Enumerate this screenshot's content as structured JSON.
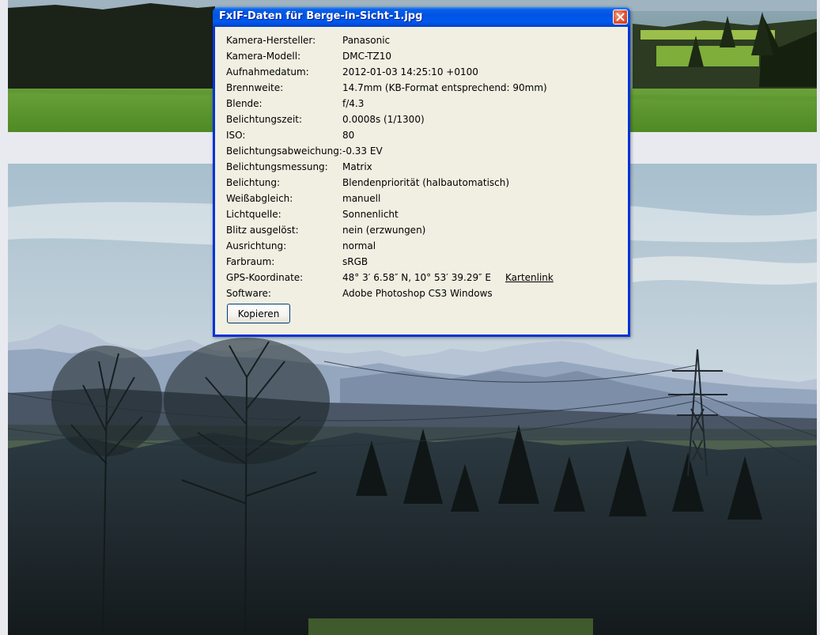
{
  "dialog": {
    "title": "FxIF-Daten für Berge-in-Sicht-1.jpg",
    "close_icon": "close-icon",
    "rows": [
      {
        "label": "Kamera-Hersteller:",
        "value": "Panasonic"
      },
      {
        "label": "Kamera-Modell:",
        "value": "DMC-TZ10"
      },
      {
        "label": "Aufnahmedatum:",
        "value": "2012-01-03 14:25:10 +0100"
      },
      {
        "label": "Brennweite:",
        "value": "14.7mm (KB-Format entsprechend: 90mm)"
      },
      {
        "label": "Blende:",
        "value": "f/4.3"
      },
      {
        "label": "Belichtungszeit:",
        "value": "0.0008s (1/1300)"
      },
      {
        "label": "ISO:",
        "value": "80"
      },
      {
        "label": "Belichtungsabweichung:",
        "value": "-0.33 EV"
      },
      {
        "label": "Belichtungsmessung:",
        "value": "Matrix"
      },
      {
        "label": "Belichtung:",
        "value": "Blendenpriorität (halbautomatisch)"
      },
      {
        "label": "Weißabgleich:",
        "value": "manuell"
      },
      {
        "label": "Lichtquelle:",
        "value": "Sonnenlicht"
      },
      {
        "label": "Blitz ausgelöst:",
        "value": "nein (erzwungen)"
      },
      {
        "label": "Ausrichtung:",
        "value": "normal"
      },
      {
        "label": "Farbraum:",
        "value": "sRGB"
      },
      {
        "label": "GPS-Koordinate:",
        "value": "48° 3′ 6.58″ N, 10° 53′ 39.29″ E"
      },
      {
        "label": "Software:",
        "value": "Adobe Photoshop CS3 Windows"
      }
    ],
    "map_link_label": "Kartenlink",
    "copy_button_label": "Kopieren"
  },
  "colors": {
    "titlebar": "#0054e3",
    "window_border": "#0831d9",
    "dialog_background": "#f0efe2",
    "close_button": "#e35e3b"
  }
}
